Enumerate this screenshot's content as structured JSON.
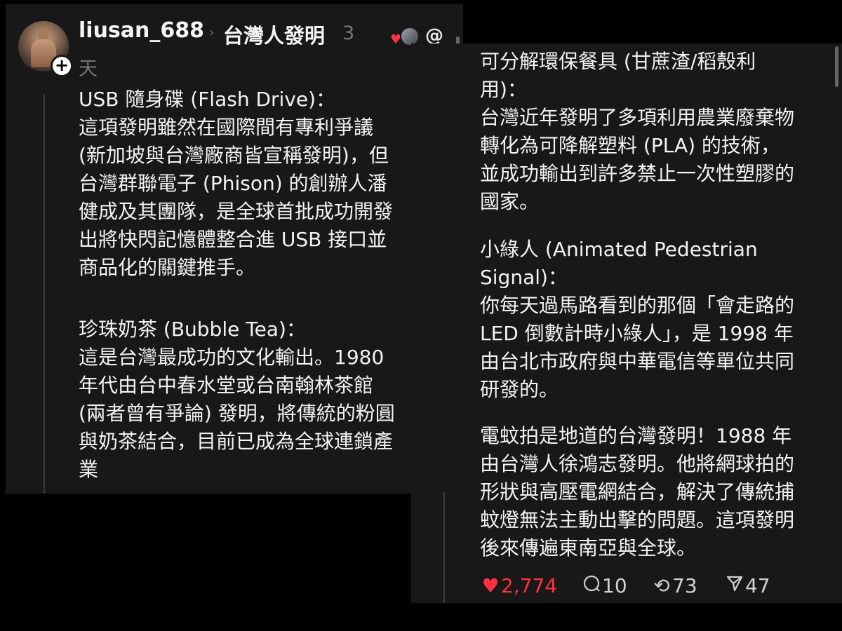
{
  "post": {
    "username": "liusan_688",
    "topic": "台灣人發明",
    "time_part1": "3",
    "time_part2": "天"
  },
  "left_panel": {
    "block1": "USB 隨身碟 (Flash Drive)：\n這項發明雖然在國際間有專利爭議\n(新加坡與台灣廠商皆宣稱發明)，但\n台灣群聯電子 (Phison) 的創辦人潘\n健成及其團隊，是全球首批成功開發\n出將快閃記憶體整合進 USB 接口並\n商品化的關鍵推手。",
    "block2": "珍珠奶茶 (Bubble Tea)：\n這是台灣最成功的文化輸出。1980\n年代由台中春水堂或台南翰林茶館\n(兩者曾有爭論) 發明，將傳統的粉圓\n與奶茶結合，目前已成為全球連鎖產\n業"
  },
  "right_panel": {
    "block1": "可分解環保餐具 (甘蔗渣/稻殼利\n用)：\n台灣近年發明了多項利用農業廢棄物\n轉化為可降解塑料 (PLA) 的技術，\n並成功輸出到許多禁止一次性塑膠的\n國家。",
    "block2": "小綠人 (Animated Pedestrian\nSignal)：\n你每天過馬路看到的那個「會走路的\nLED 倒數計時小綠人」，是 1998 年\n由台北市政府與中華電信等單位共同\n研發的。",
    "block3": "電蚊拍是地道的台灣發明！1988 年\n由台灣人徐鴻志發明。他將網球拍的\n形狀與高壓電網結合，解決了傳統捕\n蚊燈無法主動出擊的問題。這項發明\n後來傳遍東南亞與全球。"
  },
  "actions": {
    "likes": "2,774",
    "comments": "10",
    "reposts": "73",
    "shares": "47"
  },
  "icons": {
    "like": "heart-icon",
    "comment": "comment-icon",
    "repost": "repost-icon",
    "share": "send-icon",
    "app": "threads-icon",
    "follow": "plus-icon"
  },
  "colors": {
    "background": "#181818",
    "like_red": "#ff3040",
    "muted_text": "#777777"
  }
}
